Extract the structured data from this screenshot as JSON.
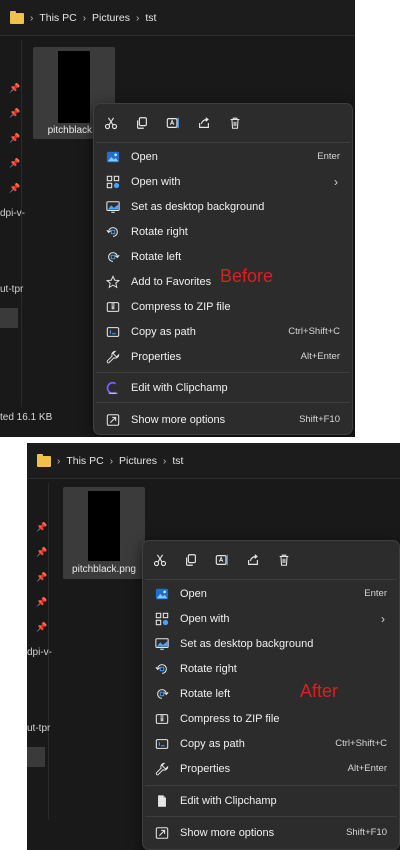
{
  "before": {
    "breadcrumb": [
      "This PC",
      "Pictures",
      "tst"
    ],
    "sidebar_texts": [
      "dpi-v-",
      "ut-tpr"
    ],
    "file_name": "pitchblack.p",
    "status": "ted  16.1 KB",
    "annotation": "Before",
    "menu": {
      "quick_actions": [
        "cut-icon",
        "copy-icon",
        "rename-icon",
        "share-icon",
        "delete-icon"
      ],
      "items": [
        {
          "label": "Open",
          "shortcut": "Enter",
          "icon": "photos-icon"
        },
        {
          "label": "Open with",
          "shortcut": "",
          "icon": "open-with-icon",
          "submenu": true
        },
        {
          "label": "Set as desktop background",
          "shortcut": "",
          "icon": "desktop-background-icon"
        },
        {
          "label": "Rotate right",
          "shortcut": "",
          "icon": "rotate-right-icon"
        },
        {
          "label": "Rotate left",
          "shortcut": "",
          "icon": "rotate-left-icon"
        },
        {
          "label": "Add to Favorites",
          "shortcut": "",
          "icon": "star-icon"
        },
        {
          "label": "Compress to ZIP file",
          "shortcut": "",
          "icon": "zip-icon"
        },
        {
          "label": "Copy as path",
          "shortcut": "Ctrl+Shift+C",
          "icon": "copy-path-icon"
        },
        {
          "label": "Properties",
          "shortcut": "Alt+Enter",
          "icon": "properties-icon"
        }
      ],
      "extra_items": [
        {
          "label": "Edit with Clipchamp",
          "shortcut": "",
          "icon": "clipchamp-icon"
        }
      ],
      "footer": {
        "label": "Show more options",
        "shortcut": "Shift+F10",
        "icon": "show-more-icon"
      }
    }
  },
  "after": {
    "breadcrumb": [
      "This PC",
      "Pictures",
      "tst"
    ],
    "sidebar_texts": [
      "dpi-v-",
      "ut-tpr"
    ],
    "file_name": "pitchblack.png",
    "annotation": "After",
    "menu": {
      "quick_actions": [
        "cut-icon",
        "copy-icon",
        "rename-icon",
        "share-icon",
        "delete-icon"
      ],
      "items": [
        {
          "label": "Open",
          "shortcut": "Enter",
          "icon": "photos-icon"
        },
        {
          "label": "Open with",
          "shortcut": "",
          "icon": "open-with-icon",
          "submenu": true
        },
        {
          "label": "Set as desktop background",
          "shortcut": "",
          "icon": "desktop-background-icon"
        },
        {
          "label": "Rotate right",
          "shortcut": "",
          "icon": "rotate-right-icon"
        },
        {
          "label": "Rotate left",
          "shortcut": "",
          "icon": "rotate-left-icon"
        },
        {
          "label": "Compress to ZIP file",
          "shortcut": "",
          "icon": "zip-icon"
        },
        {
          "label": "Copy as path",
          "shortcut": "Ctrl+Shift+C",
          "icon": "copy-path-icon"
        },
        {
          "label": "Properties",
          "shortcut": "Alt+Enter",
          "icon": "properties-icon"
        }
      ],
      "extra_items": [
        {
          "label": "Edit with Clipchamp",
          "shortcut": "",
          "icon": "document-icon"
        }
      ],
      "footer": {
        "label": "Show more options",
        "shortcut": "Shift+F10",
        "icon": "show-more-icon"
      }
    }
  },
  "colors": {
    "annotation": "#e01e1e",
    "menu_bg": "#2c2c2c",
    "window_bg": "#191919",
    "accent_blue": "#4aa3ff",
    "folder": "#f2c14a"
  }
}
